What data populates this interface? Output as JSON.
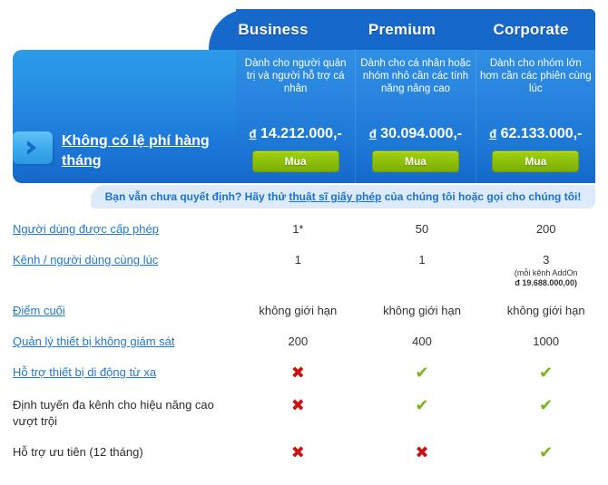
{
  "header": {
    "plans": [
      {
        "name": "Business",
        "desc": "Dành cho người quản trị và người hỗ trợ cá nhân",
        "price_currency": "đ",
        "price": "14.212.000,-",
        "buy_label": "Mua"
      },
      {
        "name": "Premium",
        "desc": "Dành cho cá nhân hoặc nhóm nhỏ cần các tính năng nâng cao",
        "price_currency": "đ",
        "price": "30.094.000,-",
        "buy_label": "Mua"
      },
      {
        "name": "Corporate",
        "desc": "Dành cho nhóm lớn hơn cần các phiên cùng lúc",
        "price_currency": "đ",
        "price": "62.133.000,-",
        "buy_label": "Mua"
      }
    ]
  },
  "lead": {
    "title": "Không có lệ phí hàng tháng",
    "arrow_icon": "chevron-right-icon"
  },
  "banner": {
    "before": "Bạn vẫn chưa quyết định? Hãy thử ",
    "link": "thuật sĩ giấy phép",
    "after": " của chúng tôi hoặc gọi cho chúng tôi!"
  },
  "features": [
    {
      "label": "Người dùng được cấp phép",
      "link": true,
      "values": [
        "1*",
        "50",
        "200"
      ],
      "types": [
        "text",
        "text",
        "text"
      ],
      "sub": [
        null,
        null,
        null
      ]
    },
    {
      "label": "Kênh / người dùng cùng lúc",
      "link": true,
      "values": [
        "1",
        "1",
        "3"
      ],
      "types": [
        "text",
        "text",
        "text"
      ],
      "sub": [
        null,
        null,
        "(mỗi kênh AddOn\nđ 19.688.000,00)"
      ]
    },
    {
      "label": "Điểm cuối",
      "link": true,
      "values": [
        "không giới hạn",
        "không giới hạn",
        "không giới hạn"
      ],
      "types": [
        "text",
        "text",
        "text"
      ],
      "sub": [
        null,
        null,
        null
      ]
    },
    {
      "label": "Quản lý thiết bị không giám sát",
      "link": true,
      "values": [
        "200",
        "400",
        "1000"
      ],
      "types": [
        "text",
        "text",
        "text"
      ],
      "sub": [
        null,
        null,
        null
      ]
    },
    {
      "label": "Hỗ trợ thiết bị di động từ xa",
      "link": true,
      "values": [
        "✖",
        "✔",
        "✔"
      ],
      "types": [
        "no",
        "yes",
        "yes"
      ],
      "sub": [
        null,
        null,
        null
      ]
    },
    {
      "label": "Định tuyến đa kênh cho hiệu năng cao vượt trội",
      "link": false,
      "values": [
        "✖",
        "✔",
        "✔"
      ],
      "types": [
        "no",
        "yes",
        "yes"
      ],
      "sub": [
        null,
        null,
        null
      ]
    },
    {
      "label": "Hỗ trợ ưu tiên (12 tháng)",
      "link": false,
      "values": [
        "✖",
        "✖",
        "✔"
      ],
      "types": [
        "no",
        "no",
        "yes"
      ],
      "sub": [
        null,
        null,
        null
      ]
    }
  ],
  "colors": {
    "header_dark_blue": "#1668ca",
    "panel_blue": "#2b9ae8",
    "buy_green": "#8dc00a",
    "banner_bg": "#dceaf9",
    "link_blue": "#2079d4",
    "yes_green": "#7ab51d",
    "no_red": "#cc1111"
  }
}
